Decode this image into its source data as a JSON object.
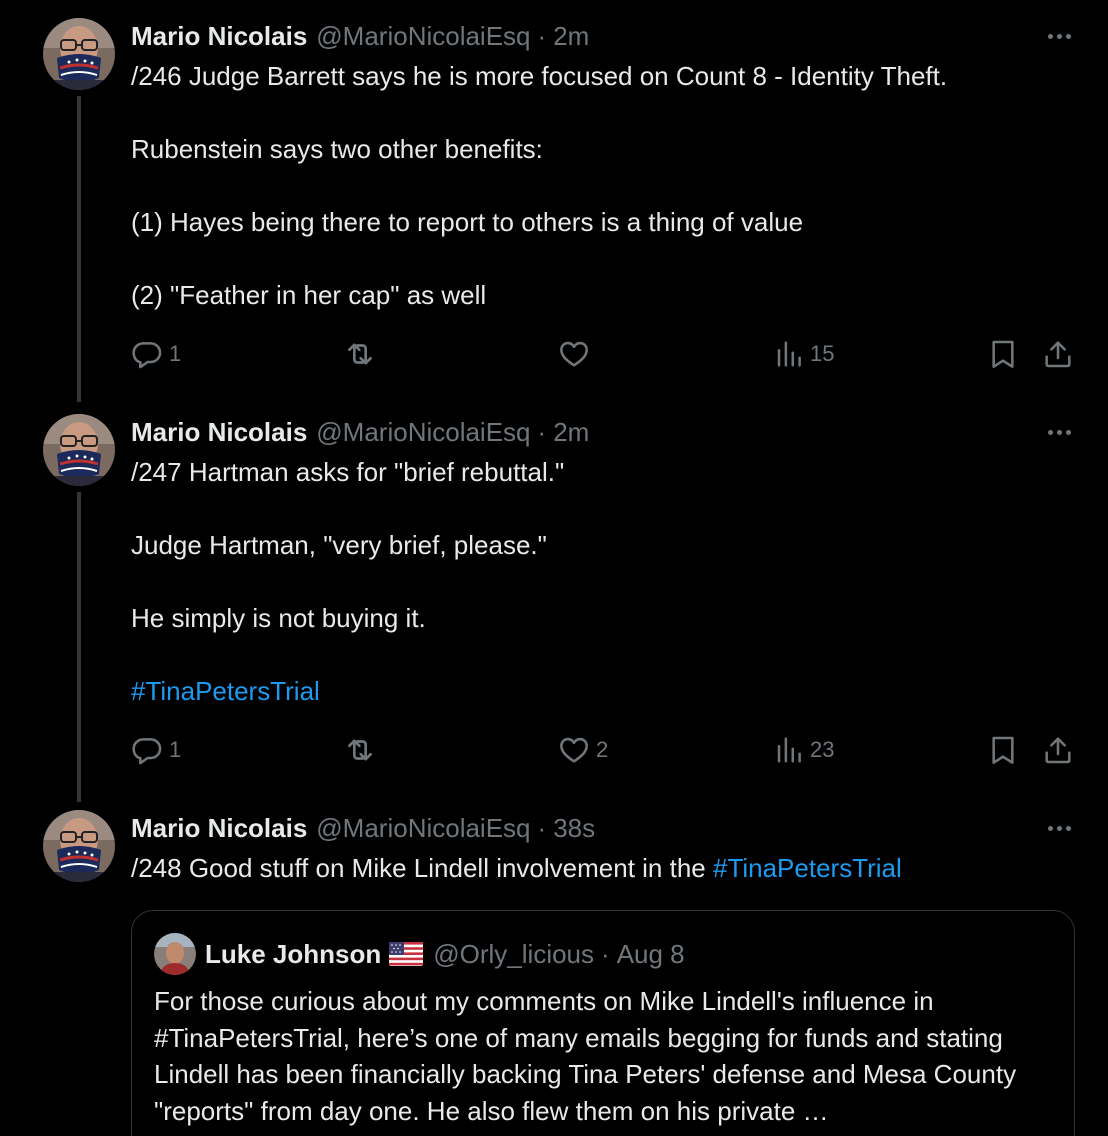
{
  "tweets": [
    {
      "author": "Mario Nicolais",
      "handle": "@MarioNicolaiEsq",
      "separator": "·",
      "time": "2m",
      "paragraphs": [
        "/246 Judge Barrett says he is more focused on Count 8 - Identity Theft.",
        "Rubenstein says two other benefits:",
        "(1) Hayes being there to report to others is a thing of value",
        "(2) \"Feather in her cap\" as well"
      ],
      "replies": "1",
      "reposts": "",
      "likes": "",
      "views": "15"
    },
    {
      "author": "Mario Nicolais",
      "handle": "@MarioNicolaiEsq",
      "separator": "·",
      "time": "2m",
      "paragraphs": [
        "/247 Hartman asks for \"brief rebuttal.\"",
        "Judge Hartman, \"very brief, please.\"",
        "He simply is not buying it."
      ],
      "hashtag": "#TinaPetersTrial",
      "replies": "1",
      "reposts": "",
      "likes": "2",
      "views": "23"
    },
    {
      "author": "Mario Nicolais",
      "handle": "@MarioNicolaiEsq",
      "separator": "·",
      "time": "38s",
      "text_before": "/248 Good stuff on Mike Lindell involvement in the ",
      "hashtag": "#TinaPetersTrial"
    }
  ],
  "quote": {
    "author": "Luke Johnson",
    "flag_icon": "us-flag-icon",
    "handle": "@Orly_licious",
    "separator": "·",
    "time": "Aug 8",
    "text": "For those curious about my comments on Mike Lindell's influence in #TinaPetersTrial, here’s one of many emails begging for funds and stating Lindell has been financially backing Tina Peters' defense and Mesa County \"reports\" from day one. He also flew them on his private …"
  },
  "icons": {
    "reply": "reply-icon",
    "repost": "repost-icon",
    "like": "heart-icon",
    "views": "views-chart-icon",
    "bookmark": "bookmark-icon",
    "share": "share-icon",
    "more": "more-dots-icon"
  },
  "colors": {
    "background": "#000000",
    "text": "#e7e9ea",
    "muted": "#71767b",
    "link": "#1d9bf0",
    "border": "#2f3336"
  }
}
